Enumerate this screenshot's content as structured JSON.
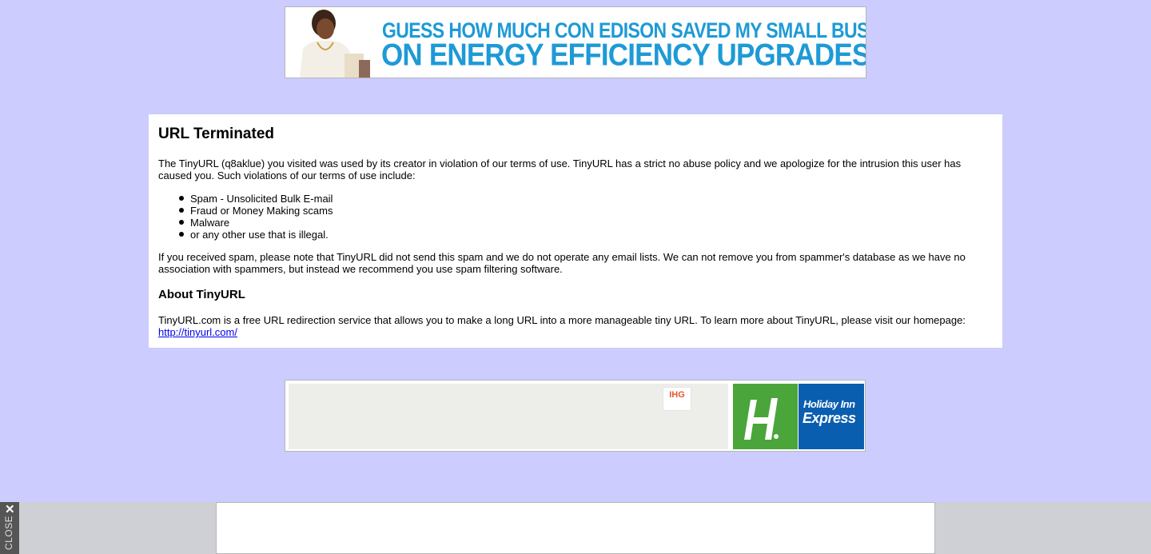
{
  "top_ad": {
    "line1": "GUESS HOW MUCH CON EDISON SAVED MY SMALL BUSINESS",
    "line2": "ON ENERGY EFFICIENCY UPGRADES?",
    "text_color": "#1e9ad6"
  },
  "notice": {
    "title": "URL Terminated",
    "intro": "The TinyURL (q8aklue) you visited was used by its creator in violation of our terms of use. TinyURL has a strict no abuse policy and we apologize for the intrusion this user has caused you. Such violations of our terms of use include:",
    "violations": [
      "Spam - Unsolicited Bulk E-mail",
      "Fraud or Money Making scams",
      "Malware",
      "or any other use that is illegal."
    ],
    "spam_note": "If you received spam, please note that TinyURL did not send this spam and we do not operate any email lists. We can not remove you from spammer's database as we have no association with spammers, but instead we recommend you use spam filtering software.",
    "about_heading": "About TinyURL",
    "about_text": "TinyURL.com is a free URL redirection service that allows you to make a long URL into a more manageable tiny URL. To learn more about TinyURL, please visit our homepage:",
    "homepage_link": "http://tinyurl.com/"
  },
  "mid_ad": {
    "ihg_logo": "IHG",
    "brand_line1": "Holiday Inn",
    "brand_line2": "Express",
    "green": "#4aa53a",
    "blue": "#0a5eb0"
  },
  "bottom_bar": {
    "close_label": "CLOSE",
    "close_icon": "close-x-icon"
  },
  "colors": {
    "page_background": "#ccccff",
    "link": "#0000ee"
  }
}
